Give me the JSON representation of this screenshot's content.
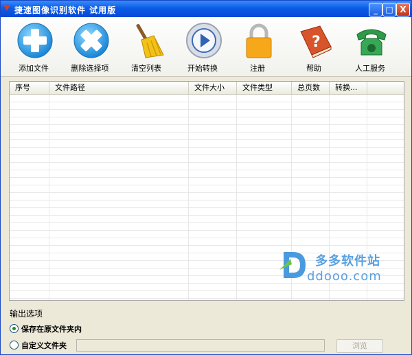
{
  "window": {
    "title": "捷速图像识别软件 试用版",
    "minimize": "_",
    "maximize": "□",
    "close": "X"
  },
  "toolbar": [
    {
      "label": "添加文件",
      "icon": "add-icon"
    },
    {
      "label": "删除选择项",
      "icon": "delete-icon"
    },
    {
      "label": "清空列表",
      "icon": "broom-icon"
    },
    {
      "label": "开始转换",
      "icon": "play-icon"
    },
    {
      "label": "注册",
      "icon": "lock-icon"
    },
    {
      "label": "帮助",
      "icon": "help-book-icon"
    },
    {
      "label": "人工服务",
      "icon": "phone-icon"
    }
  ],
  "table": {
    "columns": [
      "序号",
      "文件路径",
      "文件大小",
      "文件类型",
      "总页数",
      "转换..."
    ],
    "rows": []
  },
  "output": {
    "section_label": "输出选项",
    "option_original": "保存在原文件夹内",
    "option_custom": "自定义文件夹",
    "selected": "option_original",
    "custom_path": "",
    "browse_label": "浏览"
  },
  "watermark": {
    "text_cn": "多多软件站",
    "text_url": "ddooo.com"
  },
  "colors": {
    "titlebar": "#0a5de8",
    "watermark": "#5aa0e0",
    "window_bg": "#ece9d8"
  }
}
